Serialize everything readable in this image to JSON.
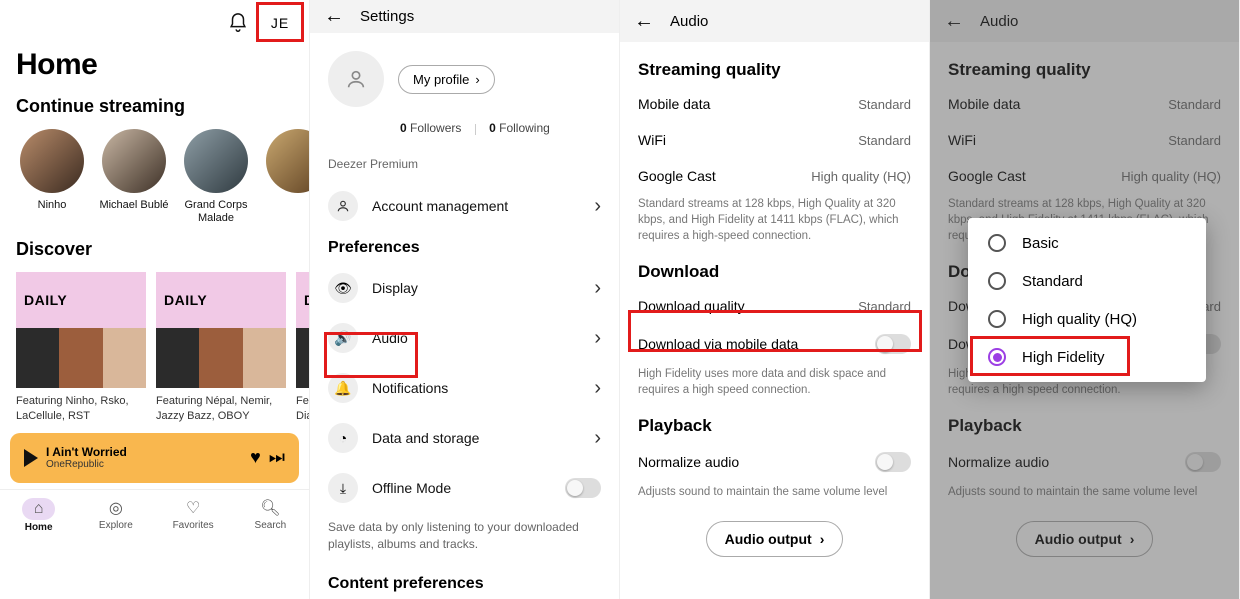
{
  "panel1": {
    "initials": "JE",
    "home_title": "Home",
    "continue_label": "Continue streaming",
    "artists": [
      {
        "name": "Ninho"
      },
      {
        "name": "Michael Bublé"
      },
      {
        "name": "Grand Corps Malade"
      },
      {
        "name": ""
      }
    ],
    "discover_label": "Discover",
    "cards": [
      {
        "tag": "DAILY",
        "caption": "Featuring Ninho, Rsko, LaCellule, RST"
      },
      {
        "tag": "DAILY",
        "caption": "Featuring Népal, Nemir, Jazzy Bazz, OBOY"
      },
      {
        "tag": "D",
        "caption": "Featuring Diar"
      }
    ],
    "player": {
      "track": "I Ain't Worried",
      "artist": "OneRepublic"
    },
    "tabs": [
      {
        "label": "Home",
        "icon": "home"
      },
      {
        "label": "Explore",
        "icon": "compass"
      },
      {
        "label": "Favorites",
        "icon": "heart"
      },
      {
        "label": "Search",
        "icon": "search"
      }
    ]
  },
  "panel2": {
    "title": "Settings",
    "my_profile": "My profile",
    "followers_count": "0",
    "followers_label": "Followers",
    "following_count": "0",
    "following_label": "Following",
    "plan": "Deezer Premium",
    "acct_mgmt": "Account management",
    "preferences": "Preferences",
    "items": [
      {
        "icon": "eye",
        "label": "Display"
      },
      {
        "icon": "audio",
        "label": "Audio"
      },
      {
        "icon": "bell",
        "label": "Notifications"
      },
      {
        "icon": "data",
        "label": "Data and storage"
      },
      {
        "icon": "offline",
        "label": "Offline Mode"
      }
    ],
    "offline_help": "Save data by only listening to your downloaded playlists, albums and tracks.",
    "content_pref": "Content preferences"
  },
  "audio": {
    "title": "Audio",
    "streaming": "Streaming quality",
    "rows": [
      {
        "label": "Mobile data",
        "value": "Standard"
      },
      {
        "label": "WiFi",
        "value": "Standard"
      },
      {
        "label": "Google Cast",
        "value": "High quality (HQ)"
      }
    ],
    "stream_note": "Standard streams at 128 kbps, High Quality at 320 kbps, and High Fidelity at 1411 kbps (FLAC), which requires a high-speed connection.",
    "download": "Download",
    "download_quality_label": "Download quality",
    "download_quality_value": "Standard",
    "download_mobile": "Download via mobile data",
    "download_note": "High Fidelity uses more data and disk space and requires a high speed connection.",
    "playback": "Playback",
    "normalize": "Normalize audio",
    "normalize_note": "Adjusts sound to maintain the same volume level",
    "audio_output": "Audio output"
  },
  "popup": {
    "options": [
      "Basic",
      "Standard",
      "High quality (HQ)",
      "High Fidelity"
    ],
    "selected": "High Fidelity"
  }
}
